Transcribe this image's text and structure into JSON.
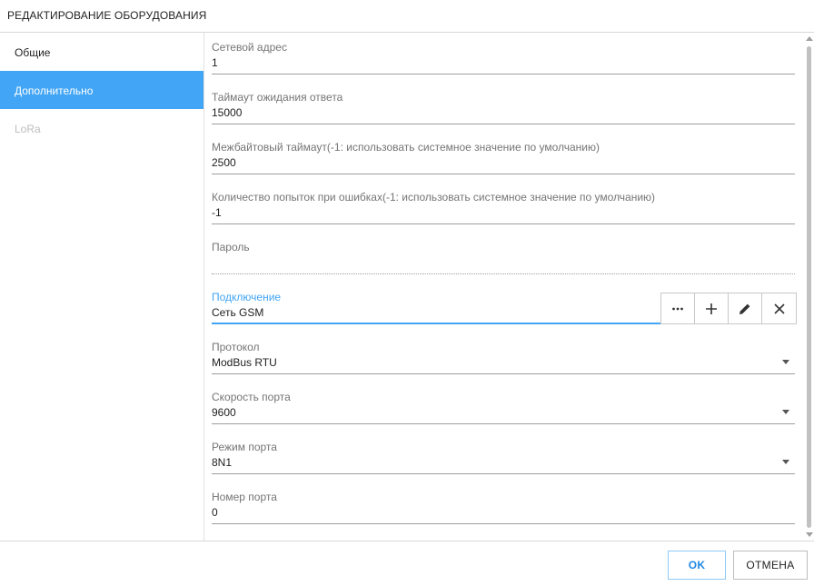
{
  "dialog": {
    "title": "РЕДАКТИРОВАНИЕ ОБОРУДОВАНИЯ"
  },
  "sidebar": {
    "items": [
      {
        "label": "Общие"
      },
      {
        "label": "Дополнительно"
      },
      {
        "label": "LoRa"
      }
    ]
  },
  "form": {
    "network_address": {
      "label": "Сетевой адрес",
      "value": "1"
    },
    "response_timeout": {
      "label": "Таймаут ожидания ответа",
      "value": "15000"
    },
    "interbyte_timeout": {
      "label": "Межбайтовый таймаут(-1: использовать системное значение по умолчанию)",
      "value": "2500"
    },
    "retry_count": {
      "label": "Количество попыток при ошибках(-1: использовать системное значение по умолчанию)",
      "value": "-1"
    },
    "password": {
      "label": "Пароль",
      "value": ""
    },
    "connection": {
      "label": "Подключение",
      "value": "Сеть GSM"
    },
    "protocol": {
      "label": "Протокол",
      "value": "ModBus RTU"
    },
    "port_speed": {
      "label": "Скорость порта",
      "value": "9600"
    },
    "port_mode": {
      "label": "Режим порта",
      "value": "8N1"
    },
    "port_number": {
      "label": "Номер порта",
      "value": "0"
    }
  },
  "footer": {
    "ok_label": "OK",
    "cancel_label": "ОТМЕНА"
  },
  "colors": {
    "accent": "#42a5f5"
  }
}
